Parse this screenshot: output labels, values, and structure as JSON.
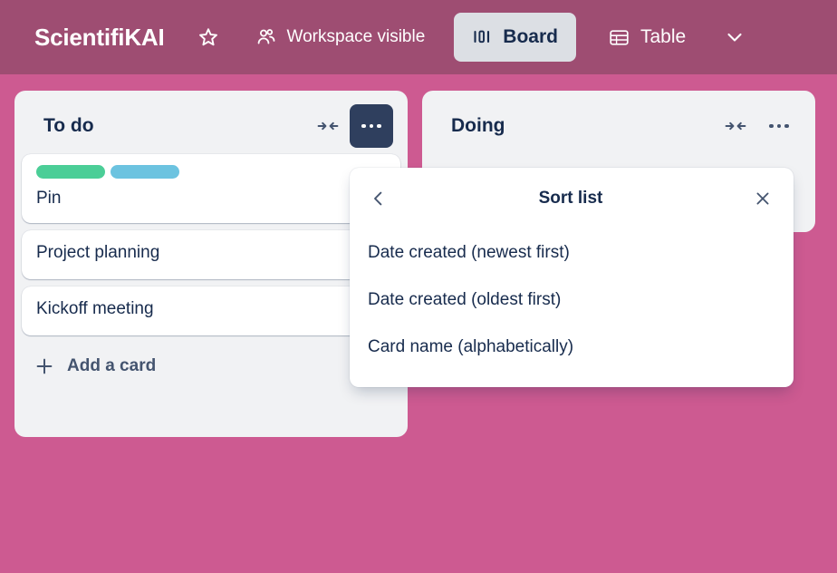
{
  "header": {
    "board_title": "ScientifiKAI",
    "star_icon": "star-outline-icon",
    "visibility": {
      "icon": "members-icon",
      "label": "Workspace visible"
    },
    "views": [
      {
        "label": "Board",
        "icon": "board-columns-icon",
        "active": true
      },
      {
        "label": "Table",
        "icon": "table-grid-icon",
        "active": false
      }
    ],
    "more_views_icon": "chevron-down-icon",
    "colors": {
      "header_bg": "#9e4d72",
      "board_bg": "#cd5a91",
      "text": "#ffffff",
      "active_pill_bg": "#dcdfe4"
    }
  },
  "lists": [
    {
      "name": "To do",
      "collapse_icon": "collapse-list-icon",
      "menu_icon": "list-actions-icon",
      "menu_active": true,
      "cards": [
        {
          "title": "Pin",
          "labels": [
            {
              "name": "green-label",
              "color": "#4bce97"
            },
            {
              "name": "blue-label",
              "color": "#6cc3e0"
            }
          ]
        },
        {
          "title": "Project planning",
          "labels": []
        },
        {
          "title": "Kickoff meeting",
          "labels": []
        }
      ],
      "add_card": {
        "icon": "plus-icon",
        "label": "Add a card",
        "template_icon": "card-template-icon"
      }
    },
    {
      "name": "Doing",
      "collapse_icon": "collapse-list-icon",
      "menu_icon": "list-actions-icon",
      "menu_active": false,
      "cards": [],
      "add_card": {
        "icon": "plus-icon",
        "label": "",
        "template_icon": "card-template-icon"
      }
    }
  ],
  "popup": {
    "title": "Sort list",
    "back_icon": "chevron-left-icon",
    "close_icon": "close-icon",
    "options": [
      "Date created (newest first)",
      "Date created (oldest first)",
      "Card name (alphabetically)"
    ]
  }
}
